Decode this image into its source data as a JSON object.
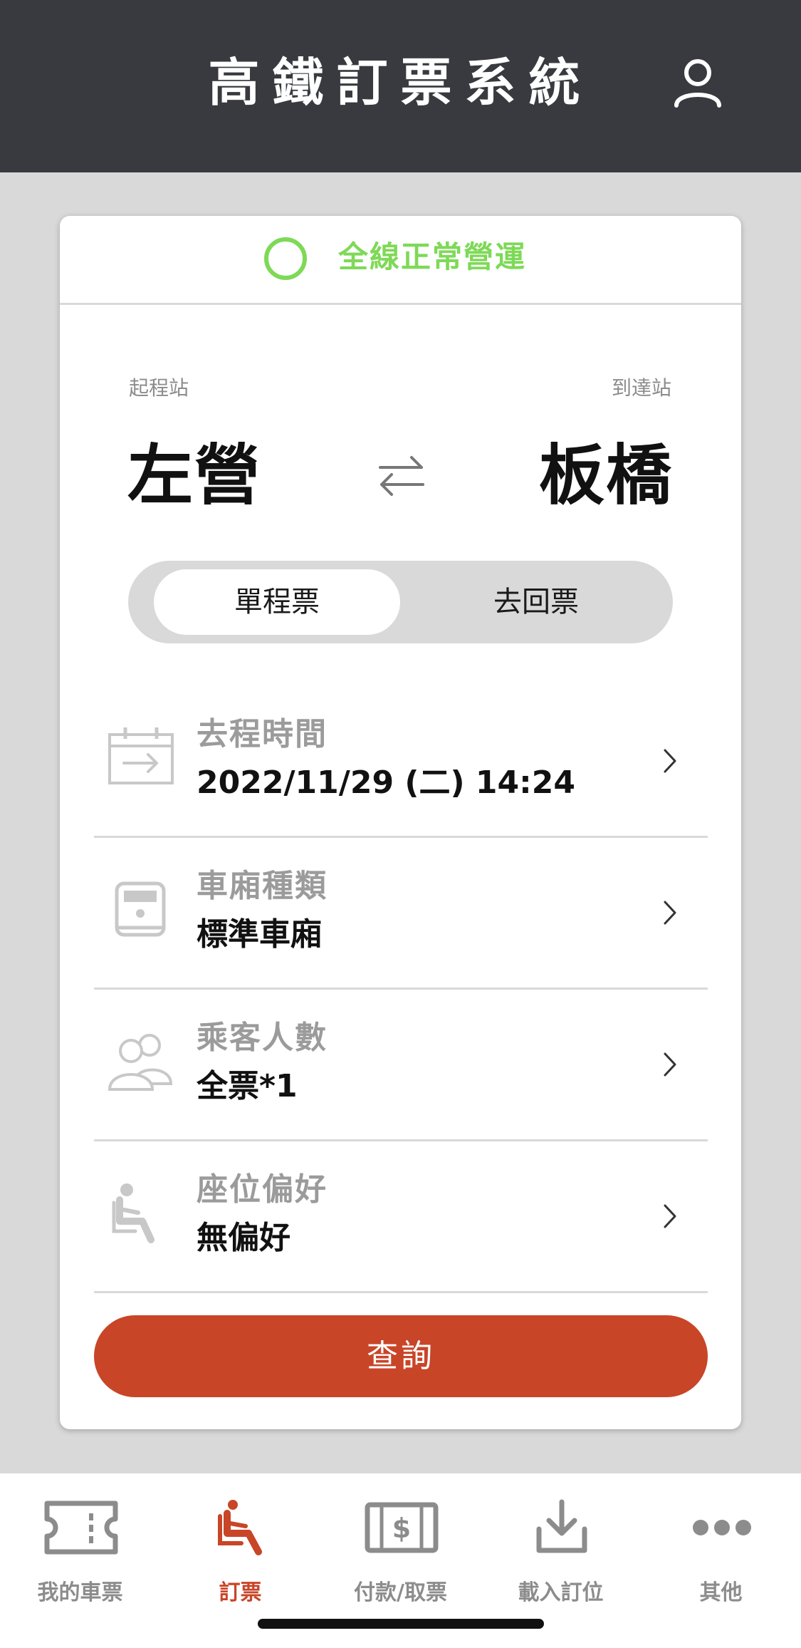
{
  "header": {
    "title": "高鐵訂票系統",
    "profile_icon": "person-icon"
  },
  "status": {
    "text": "全線正常營運",
    "color": "#7ed957"
  },
  "route": {
    "from_label": "起程站",
    "from_station": "左營",
    "to_label": "到達站",
    "to_station": "板橋",
    "swap_icon": "swap-arrows-icon"
  },
  "trip_type": {
    "options": [
      "單程票",
      "去回票"
    ],
    "selected": "單程票"
  },
  "options": [
    {
      "label": "去程時間",
      "value": "2022/11/29 (二) 14:24",
      "icon": "calendar-arrow-icon"
    },
    {
      "label": "車廂種類",
      "value": "標準車廂",
      "icon": "train-car-icon"
    },
    {
      "label": "乘客人數",
      "value": "全票*1",
      "icon": "passengers-icon"
    },
    {
      "label": "座位偏好",
      "value": "無偏好",
      "icon": "seat-icon"
    }
  ],
  "search_button": {
    "label": "查詢",
    "color": "#c84528"
  },
  "tabbar": {
    "active": "訂票",
    "items": [
      {
        "label": "我的車票",
        "icon": "ticket-icon"
      },
      {
        "label": "訂票",
        "icon": "seat-icon"
      },
      {
        "label": "付款/取票",
        "icon": "cash-icon"
      },
      {
        "label": "載入訂位",
        "icon": "download-icon"
      },
      {
        "label": "其他",
        "icon": "more-dots-icon"
      }
    ]
  }
}
